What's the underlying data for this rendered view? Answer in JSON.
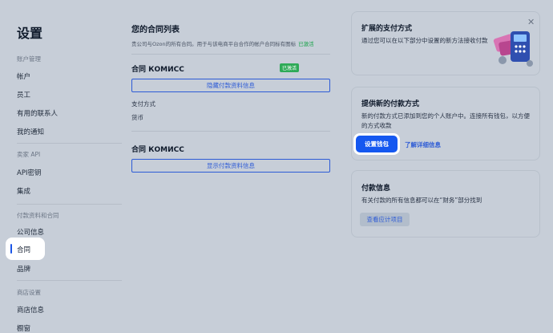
{
  "sidebar": {
    "title": "设置",
    "sections": [
      {
        "label": "账户管理",
        "items": [
          "帐户",
          "员工",
          "有用的联系人",
          "我的通知"
        ]
      },
      {
        "label": "卖家 API",
        "items": [
          "API密钥",
          "集成"
        ]
      },
      {
        "label": "付款资料和合同",
        "items": [
          "公司信息",
          "合同",
          "品牌"
        ]
      },
      {
        "label": "商店设置",
        "items": [
          "商店信息",
          "橱窗"
        ]
      }
    ],
    "active_item": "合同"
  },
  "contracts": {
    "title": "您的合同列表",
    "subtitle": "贵公司与Ozon的所有合同。用于与该电商平台合作的帐户合同标有图标",
    "subtitle_status": "已激活",
    "list": [
      {
        "name": "合同 КОМИСС",
        "badge": "已激活",
        "toggle_label": "隐藏付款资料信息",
        "fields": [
          "支付方式",
          "货币"
        ]
      },
      {
        "name": "合同 КОМИСС",
        "toggle_label": "显示付款资料信息"
      }
    ]
  },
  "promo": {
    "title": "扩展的支付方式",
    "text": "通过您可以在以下部分中设置的新方法接收付款",
    "close_icon": "close-icon"
  },
  "new_method": {
    "title": "提供新的付款方式",
    "text": "新的付款方式已添加到您的个人账户中。连接所有钱包，以方便的方式收款",
    "primary_button": "设置钱包",
    "link": "了解详细信息"
  },
  "payment_info": {
    "title": "付款信息",
    "text": "有关付款的所有信息都可以在“财务”部分找到",
    "button": "查看应计项目"
  },
  "colors": {
    "accent": "#1558f0",
    "success": "#2eaa57",
    "overlay_bg": "#c7ced8"
  }
}
